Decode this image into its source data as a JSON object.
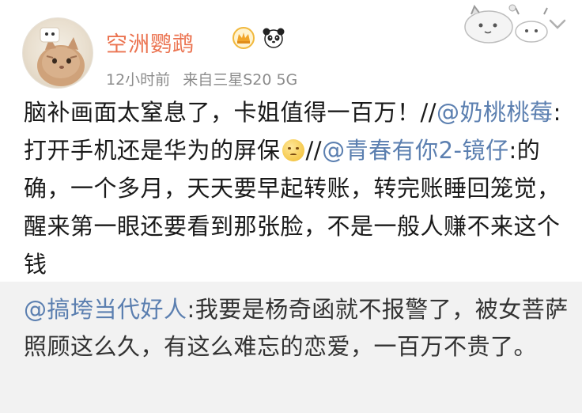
{
  "post": {
    "username": "空洲鹦鹉",
    "time": "12小时前",
    "source": "来自三星S20 5G",
    "text": {
      "p1": "脑补画面太窒息了，卡姐值得一百万！//",
      "mention1": "@奶桃桃莓",
      "p2": ":打开手机还是华为的屏保",
      "p3": "//",
      "mention2": "@青春有你2-镜仔",
      "p4": ":的确，一个多月，天天要早起转账，转完账睡回笼觉，醒来第一眼还要看到那张脸，不是一般人赚不来这个钱"
    }
  },
  "repost": {
    "mention": "@搞垮当代好人",
    "text": ":我要是杨奇函就不报警了，被女菩萨照顾这么久，有这么难忘的恋爱，一百万不贵了。"
  },
  "colors": {
    "username": "#eb7350",
    "link": "#5b7fb0",
    "repost_bg": "#f2f2f2"
  },
  "icons": [
    "avatar-cat",
    "crown-badge-icon",
    "panda-icon",
    "cartoon-decoration",
    "chevron-down-icon",
    "sleepy-emoji-icon"
  ]
}
